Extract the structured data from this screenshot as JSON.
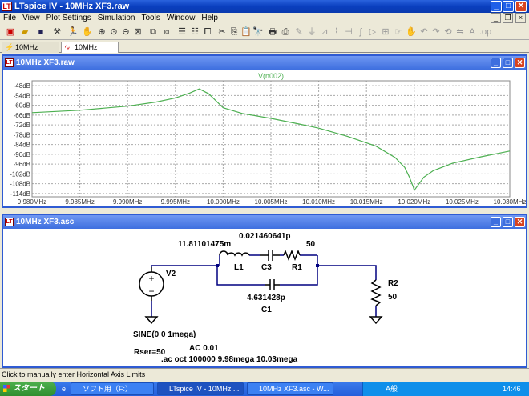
{
  "app": {
    "title": "LTspice IV - 10MHz XF3.raw",
    "icon": "ltspice-icon"
  },
  "menu": [
    "File",
    "View",
    "Plot Settings",
    "Simulation",
    "Tools",
    "Window",
    "Help"
  ],
  "tabs": [
    {
      "label": "10MHz XF3.asc",
      "icon": "schematic-icon"
    },
    {
      "label": "10MHz XF3.raw",
      "icon": "waveform-icon"
    }
  ],
  "waveform": {
    "title": "10MHz XF3.raw",
    "trace_label": "V(n002)",
    "trace_color": "#4CAF50",
    "y_ticks": [
      "-48dB",
      "-54dB",
      "-60dB",
      "-66dB",
      "-72dB",
      "-78dB",
      "-84dB",
      "-90dB",
      "-96dB",
      "-102dB",
      "-108dB",
      "-114dB"
    ],
    "x_ticks": [
      "9.980MHz",
      "9.985MHz",
      "9.990MHz",
      "9.995MHz",
      "10.000MHz",
      "10.005MHz",
      "10.010MHz",
      "10.015MHz",
      "10.020MHz",
      "10.025MHz",
      "10.030MHz"
    ]
  },
  "chart_data": {
    "type": "line",
    "title": "V(n002)",
    "xlabel": "",
    "ylabel": "",
    "x_unit": "MHz",
    "y_unit": "dB",
    "xlim": [
      9.98,
      10.03
    ],
    "ylim": [
      -116,
      -45
    ],
    "grid": true,
    "series": [
      {
        "name": "V(n002)",
        "x": [
          9.98,
          9.985,
          9.99,
          9.993,
          9.995,
          9.9965,
          9.9975,
          9.9985,
          10.0,
          10.002,
          10.005,
          10.008,
          10.01,
          10.013,
          10.016,
          10.018,
          10.019,
          10.0195,
          10.0199,
          10.02,
          10.0205,
          10.021,
          10.022,
          10.024,
          10.027,
          10.03
        ],
        "y": [
          -64.5,
          -63,
          -60.5,
          -58,
          -55.5,
          -52.5,
          -50,
          -53,
          -61.5,
          -65,
          -68,
          -71.5,
          -74,
          -79,
          -85,
          -92,
          -98,
          -104,
          -110,
          -112,
          -108,
          -104,
          -100,
          -95.5,
          -91.5,
          -88
        ]
      }
    ]
  },
  "schematic": {
    "title": "10MHz XF3.asc",
    "components": {
      "L1": {
        "name": "L1",
        "value": "11.81101475m"
      },
      "C3": {
        "name": "C3",
        "value": "0.021460641p"
      },
      "R1": {
        "name": "R1",
        "value": "50"
      },
      "C1": {
        "name": "C1",
        "value": "4.631428p"
      },
      "R2": {
        "name": "R2",
        "value": "50"
      },
      "V2": {
        "name": "V2",
        "value": "SINE(0 0 1mega)"
      }
    },
    "directives": {
      "ac": "AC 0.01",
      "rser": "Rser=50",
      "sim": ".ac oct 100000 9.98mega 10.03mega"
    }
  },
  "status": {
    "text": "Click to manually enter Horizontal Axis Limits"
  },
  "taskbar": {
    "start": "スタート",
    "buttons": [
      "ソフト用（F:）",
      "LTspice IV - 10MHz ...",
      "10MHz XF3.asc - W..."
    ],
    "ime": "A般",
    "clock": "14:46"
  }
}
